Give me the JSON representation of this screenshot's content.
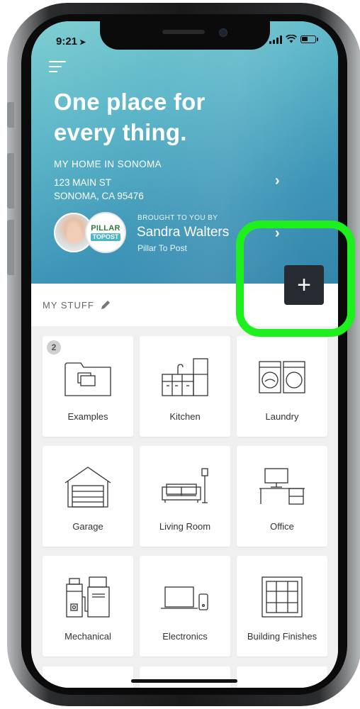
{
  "status_bar": {
    "time": "9:21"
  },
  "hero": {
    "headline_line1": "One place for",
    "headline_line2": "every thing.",
    "home_label": "MY HOME IN SONOMA",
    "address_line1": "123 MAIN ST",
    "address_line2": "SONOMA, CA 95476",
    "brought_label": "BROUGHT TO YOU BY",
    "agent_name": "Sandra Walters",
    "agent_company": "Pillar To Post",
    "logo_line1": "PILLAR",
    "logo_line2": "TOPOST"
  },
  "section": {
    "title": "MY STUFF"
  },
  "add_button": {
    "icon": "plus-icon"
  },
  "tiles": [
    {
      "label": "Examples",
      "icon": "folder-icon",
      "badge": "2"
    },
    {
      "label": "Kitchen",
      "icon": "kitchen-icon"
    },
    {
      "label": "Laundry",
      "icon": "laundry-icon"
    },
    {
      "label": "Garage",
      "icon": "garage-icon"
    },
    {
      "label": "Living Room",
      "icon": "sofa-icon"
    },
    {
      "label": "Office",
      "icon": "desk-icon"
    },
    {
      "label": "Mechanical",
      "icon": "mechanical-icon"
    },
    {
      "label": "Electronics",
      "icon": "laptop-icon"
    },
    {
      "label": "Building Finishes",
      "icon": "window-icon"
    }
  ],
  "colors": {
    "hero_top": "#7fcfd2",
    "hero_bottom": "#3485ab",
    "add_button": "#262b31",
    "highlight": "#1ef01e"
  }
}
